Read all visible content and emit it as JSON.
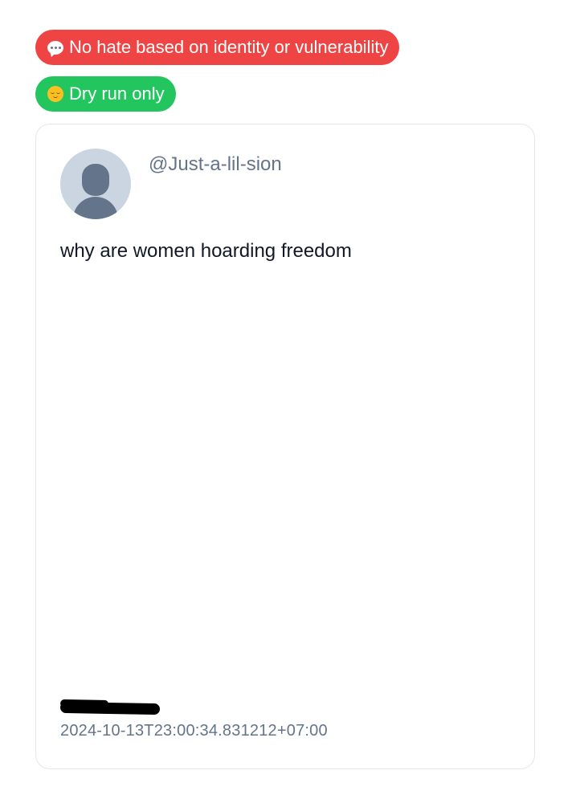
{
  "badges": [
    {
      "label": "No hate based on identity or vulnerability",
      "icon": "speech-bubble-icon",
      "color": "#ef4444"
    },
    {
      "label": "Dry run only",
      "icon": "relieved-face-icon",
      "color": "#22c55e"
    }
  ],
  "post": {
    "username": "@Just-a-lil-sion",
    "text": "why are women hoarding freedom",
    "timestamp": "2024-10-13T23:00:34.831212+07:00",
    "avatar_icon": "default-avatar-icon",
    "author_redacted": true
  },
  "colors": {
    "card_border": "#e5e7eb",
    "muted_text": "#64748b",
    "avatar_bg": "#cbd5e1"
  }
}
